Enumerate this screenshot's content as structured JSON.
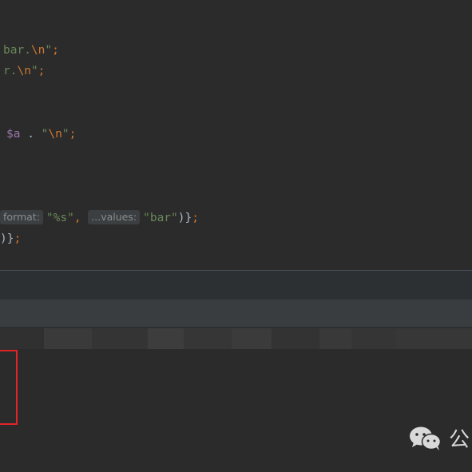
{
  "editor": {
    "lines": [
      {
        "pre": "",
        "string": "bar.",
        "escape": "\\n",
        "close": "\";"
      },
      {
        "pre": "",
        "string": "r.",
        "escape": "\\n",
        "close": "\";"
      },
      {
        "var": "$a",
        "op": " . ",
        "string_open": "\"",
        "escape": "\\n",
        "close": "\";"
      },
      {
        "hint1": "format:",
        "arg1": "\"%s\"",
        "comma": ", ",
        "hint2": "...values:",
        "arg2": "\"bar\"",
        "close": ")};"
      },
      {
        "close": ")};"
      }
    ]
  },
  "watermark": {
    "icon": "wechat-icon",
    "text": "公"
  },
  "colors": {
    "background": "#2b2b2b",
    "string": "#6a8759",
    "keyword": "#cc7832",
    "variable": "#9876aa",
    "highlight": "#e2242a"
  }
}
